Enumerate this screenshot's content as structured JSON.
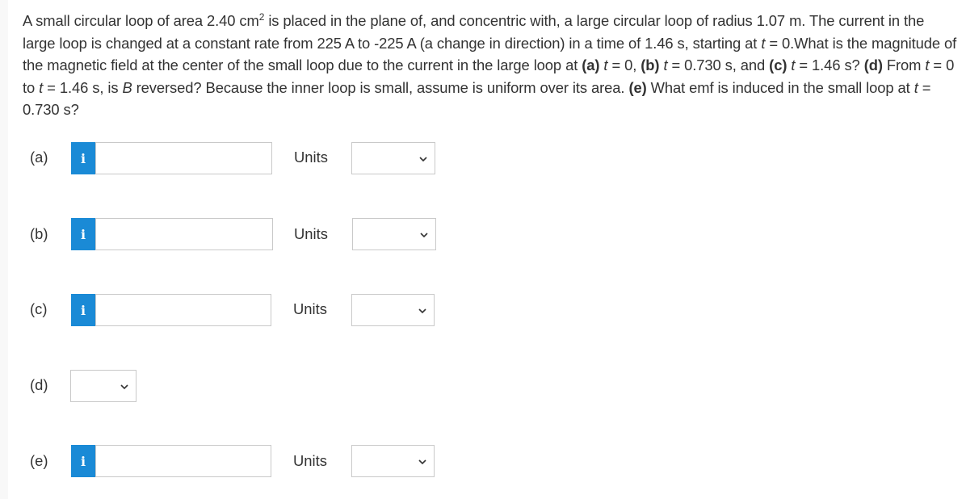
{
  "question": {
    "s1": "A small circular loop of area 2.40 cm",
    "sup": "2",
    "s2": " is placed in the plane of, and concentric with, a large circular loop of radius 1.07 m. The current in the large loop is changed at a constant rate from 225 A to -225 A (a change in direction) in a time of 1.46 s, starting at ",
    "t": "t",
    "s3": " = 0.What is the magnitude of the magnetic field at the center of the small loop due to the current in the large loop at ",
    "pa": "(a)",
    "s4": " = 0, ",
    "pb": "(b)",
    "s5": " = 0.730 s, and ",
    "pc": "(c)",
    "s6": " = 1.46 s? ",
    "pd": "(d)",
    "s7": " From ",
    "s8": " = 0 to ",
    "s9": " = 1.46 s, is ",
    "B": "B",
    "s10": " reversed? Because the inner loop is small, assume is uniform over its area. ",
    "pe": "(e)",
    "s11": " What emf is induced in the small loop at ",
    "s12": " = 0.730 s?"
  },
  "parts": [
    {
      "label": "(a)",
      "info": "i",
      "value": "",
      "units_label": "Units",
      "units_value": ""
    },
    {
      "label": "(b)",
      "info": "i",
      "value": "",
      "units_label": "Units",
      "units_value": ""
    },
    {
      "label": "(c)",
      "info": "i",
      "value": "",
      "units_label": "Units",
      "units_value": ""
    },
    {
      "label": "(d)",
      "selected": ""
    },
    {
      "label": "(e)",
      "info": "i",
      "value": "",
      "units_label": "Units",
      "units_value": ""
    }
  ],
  "icons": {
    "info": "info-icon",
    "dropdown": "chevron-down-icon"
  },
  "colors": {
    "info_button": "#1a8ad6",
    "text": "#333333",
    "border": "#c9c9c9"
  }
}
